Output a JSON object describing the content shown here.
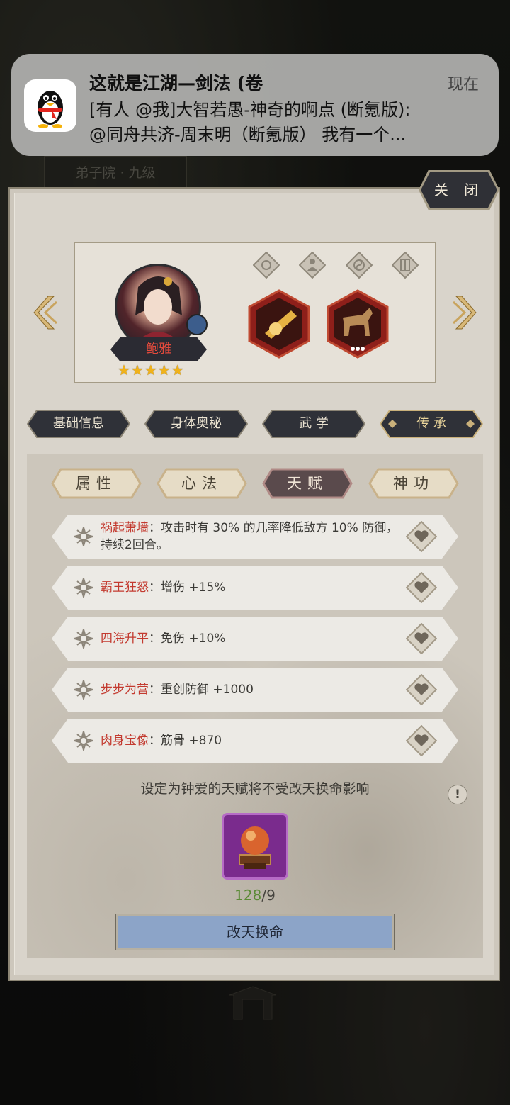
{
  "notification": {
    "title": "这就是江湖—剑法 (卷",
    "time": "现在",
    "line1": "[有人 @我]大智若愚-神奇的啊点 (断氪版):",
    "line2": "@同舟共济-周末明（断氪版） 我有一个..."
  },
  "background": {
    "location_label": "弟子院 · 九级"
  },
  "panel": {
    "close_label": "关 闭"
  },
  "hero": {
    "name": "鲍雅",
    "stars": "★★★★★"
  },
  "main_tabs": [
    {
      "label": "基础信息"
    },
    {
      "label": "身体奥秘"
    },
    {
      "label": "武 学"
    },
    {
      "label": "传 承"
    }
  ],
  "sub_tabs": [
    {
      "label": "属性"
    },
    {
      "label": "心法"
    },
    {
      "label": "天赋"
    },
    {
      "label": "神功"
    }
  ],
  "talents": [
    {
      "name": "祸起萧墙",
      "desc": "：攻击时有 30% 的几率降低敌方 10% 防御，持续2回合。"
    },
    {
      "name": "霸王狂怒",
      "desc": "：增伤 +15%"
    },
    {
      "name": "四海升平",
      "desc": "：免伤 +10%"
    },
    {
      "name": "步步为营",
      "desc": "：重创防御 +1000"
    },
    {
      "name": "肉身宝像",
      "desc": "：筋骨 +870"
    }
  ],
  "hint": "设定为钟爱的天赋将不受改天换命影响",
  "info_glyph": "!",
  "item_count": {
    "have": "128",
    "need": "/9"
  },
  "action_button": "改天换命",
  "colors": {
    "talent_name": "#c33a2f",
    "count_have": "#5a8a34",
    "button": "#8ca4c8",
    "name_plate_text": "#e24a3c"
  }
}
